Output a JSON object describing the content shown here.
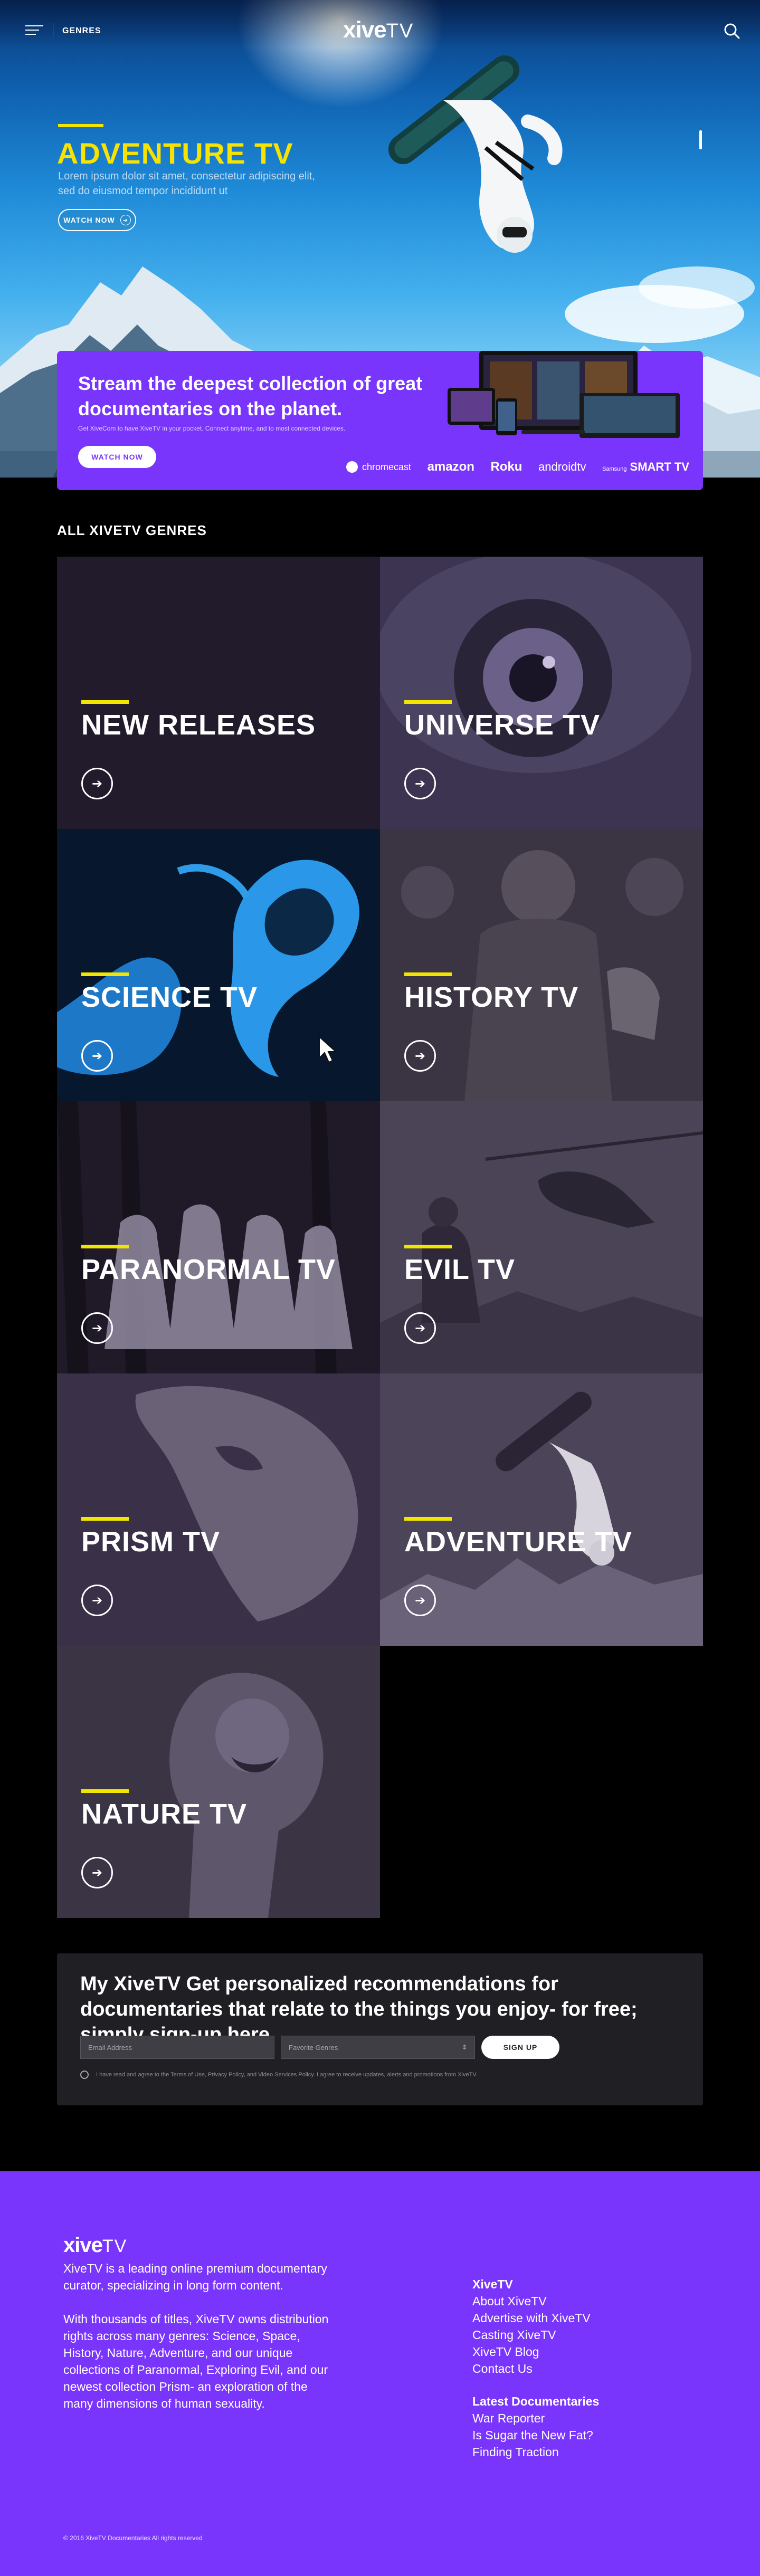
{
  "header": {
    "menu_icon": "hamburger-icon",
    "nav_label": "GENRES",
    "logo_main": "xive",
    "logo_tv": "TV",
    "search_icon": "search-icon"
  },
  "hero": {
    "title": "ADVENTURE TV",
    "description": "Lorem ipsum dolor sit amet, consectetur adipiscing elit, sed do eiusmod tempor incididunt ut",
    "cta_label": "WATCH NOW",
    "accent_color": "#f2e500"
  },
  "promo": {
    "headline": "Stream the deepest collection of great documentaries on the planet.",
    "subtext": "Get XiveCom to have XiveTV in your pocket. Connect anytime, and to most connected devices.",
    "cta_label": "WATCH NOW",
    "partners": [
      "chromecast",
      "amazon",
      "Roku",
      "androidtv",
      "Samsung",
      "SMART TV"
    ],
    "background_color": "#7a35fd"
  },
  "genres": {
    "section_title": "ALL XIVETV GENRES",
    "items": [
      {
        "label": "NEW RELEASES"
      },
      {
        "label": "UNIVERSE TV"
      },
      {
        "label": "SCIENCE TV"
      },
      {
        "label": "HISTORY TV"
      },
      {
        "label": "PARANORMAL TV"
      },
      {
        "label": "EVIL TV"
      },
      {
        "label": "PRISM TV"
      },
      {
        "label": "ADVENTURE TV"
      },
      {
        "label": "NATURE TV"
      }
    ],
    "arrow_icon": "arrow-right-icon"
  },
  "signup": {
    "headline": "My XiveTV Get personalized recommendations for documentaries that relate to the things you enjoy- for free; simply sign-up here.",
    "email_placeholder": "Email Address",
    "genre_placeholder": "Favorite Genres",
    "button_label": "SIGN UP",
    "agreement": "I have read and agree to the Terms of Use, Privacy Policy, and Video Services Policy. I agree to receive updates, alerts and promotions from XiveTV."
  },
  "footer": {
    "logo_main": "xive",
    "logo_tv": "TV",
    "about_1": "XiveTV is a leading online premium documentary curator, specializing in long form content.",
    "about_2": "With thousands of titles, XiveTV owns distribution rights across many genres: Science, Space, History, Nature, Adventure, and our unique collections of Paranormal, Exploring Evil, and our newest collection Prism- an exploration of the many dimensions of human sexuality.",
    "col1_title": "XiveTV",
    "col1_links": [
      "About XiveTV",
      "Advertise with XiveTV",
      "Casting XiveTV",
      "XiveTV Blog",
      "Contact Us"
    ],
    "col2_title": "Latest Documentaries",
    "col2_links": [
      "War Reporter",
      "Is Sugar the New Fat?",
      "Finding Traction"
    ],
    "copyright": "© 2016 XiveTV Documentaries All rights reserved"
  }
}
